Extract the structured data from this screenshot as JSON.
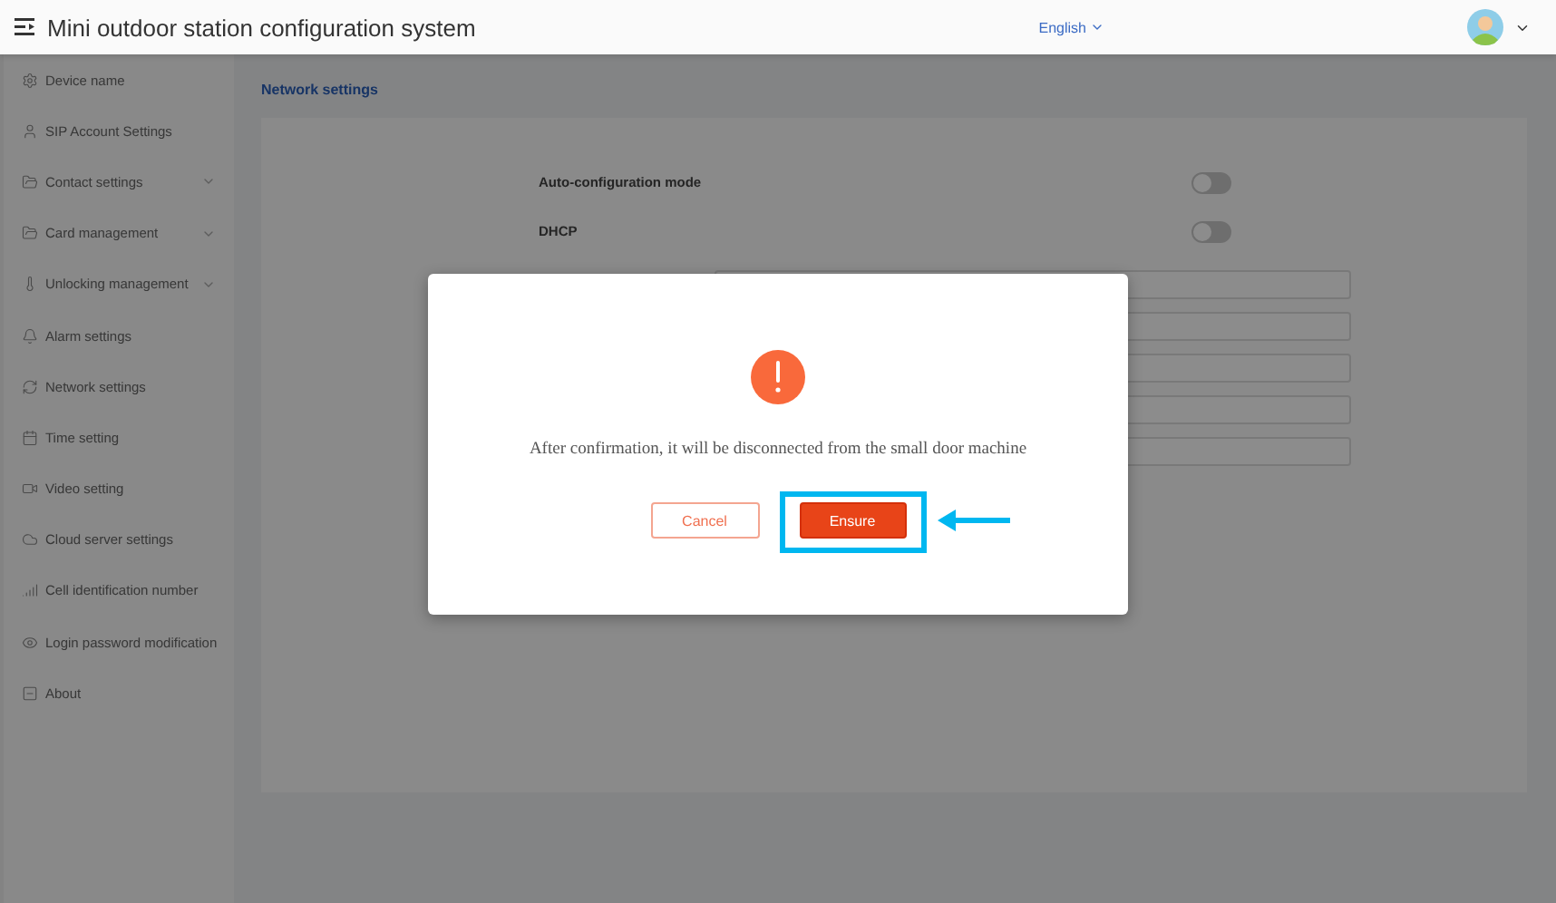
{
  "header": {
    "title": "Mini outdoor station configuration system",
    "language": "English"
  },
  "sidebar": {
    "items": [
      {
        "label": "Device name",
        "has_submenu": false
      },
      {
        "label": "SIP Account Settings",
        "has_submenu": false
      },
      {
        "label": "Contact settings",
        "has_submenu": true
      },
      {
        "label": "Card management",
        "has_submenu": true
      },
      {
        "label": "Unlocking management",
        "has_submenu": true
      },
      {
        "label": "Alarm settings",
        "has_submenu": false
      },
      {
        "label": "Network settings",
        "has_submenu": false
      },
      {
        "label": "Time setting",
        "has_submenu": false
      },
      {
        "label": "Video setting",
        "has_submenu": false
      },
      {
        "label": "Cloud server settings",
        "has_submenu": false
      },
      {
        "label": "Cell identification number",
        "has_submenu": false
      },
      {
        "label": "Login password modification",
        "has_submenu": false
      },
      {
        "label": "About",
        "has_submenu": false
      }
    ]
  },
  "page": {
    "title": "Network settings",
    "switches": [
      {
        "label": "Auto-configuration mode",
        "on": false
      },
      {
        "label": "DHCP",
        "on": false
      }
    ]
  },
  "dialog": {
    "message": "After confirmation, it will be disconnected from the small door machine",
    "buttons": [
      {
        "label": "Cancel",
        "kind": "secondary",
        "highlighted": false
      },
      {
        "label": "Ensure",
        "kind": "primary",
        "highlighted": true
      }
    ]
  }
}
